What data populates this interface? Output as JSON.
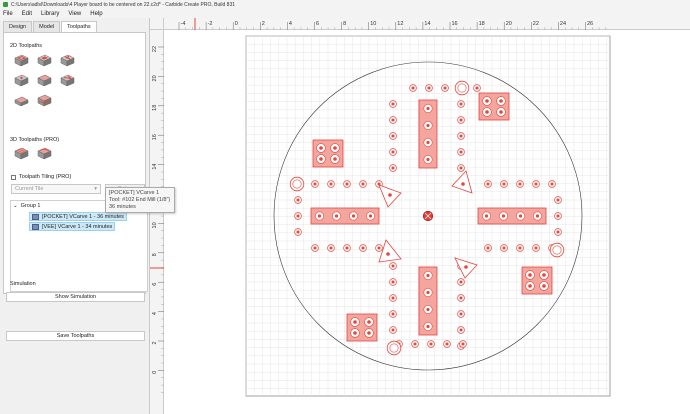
{
  "window": {
    "title": "C:\\Users\\adlsl\\Downloads\\4 Player board to be centered on 22.c2d* - Carbide Create PRO, Build 831"
  },
  "menu": [
    "File",
    "Edit",
    "Library",
    "View",
    "Help"
  ],
  "tabs": [
    {
      "label": "Design",
      "active": false
    },
    {
      "label": "Model",
      "active": false
    },
    {
      "label": "Toolpaths",
      "active": true
    }
  ],
  "toolpaths_2d": {
    "title": "2D Toolpaths",
    "tools": [
      "contour-toolpath-icon",
      "pocket-toolpath-icon",
      "vcarve-toolpath-icon",
      "drill-toolpath-icon",
      "texture-toolpath-icon",
      "advanced-vcarve-icon",
      "rough-clear-icon",
      "chamfer-toolpath-icon"
    ]
  },
  "toolpaths_3d": {
    "title": "3D Toolpaths (PRO)",
    "tools": [
      "3d-rough-icon",
      "3d-finish-icon"
    ]
  },
  "tiling": {
    "label": "Toolpath Tiling (PRO)",
    "select_value": "Current Tile",
    "setup_label": "Setup"
  },
  "tree": {
    "group_label": "Group 1",
    "items": [
      {
        "label": "[POCKET] VCarve 1 - 36 minutes",
        "selected": true
      },
      {
        "label": "[VEE] VCarve 1 - 34 minutes",
        "selected": true
      }
    ]
  },
  "tooltip": {
    "line1": "[POCKET] VCarve 1",
    "line2": "Tool: #102 End Mill (1/8\")",
    "line3": "36 minutes"
  },
  "simulation": {
    "title": "Simulation",
    "show_label": "Show Simulation"
  },
  "save_label": "Save Toolpaths",
  "ruler": {
    "x_labels": [
      "-4",
      "-2",
      "0",
      "2",
      "4",
      "6",
      "8",
      "10",
      "12",
      "14",
      "16",
      "18",
      "20",
      "22",
      "24",
      "26"
    ],
    "y_labels": [
      "22",
      "20",
      "18",
      "16",
      "14",
      "12",
      "10",
      "8",
      "6",
      "4",
      "2",
      "0"
    ]
  },
  "colors": {
    "accent": "#e8453c",
    "toolpath_fill": "#f3a59e",
    "selection": "#cde8f7"
  }
}
